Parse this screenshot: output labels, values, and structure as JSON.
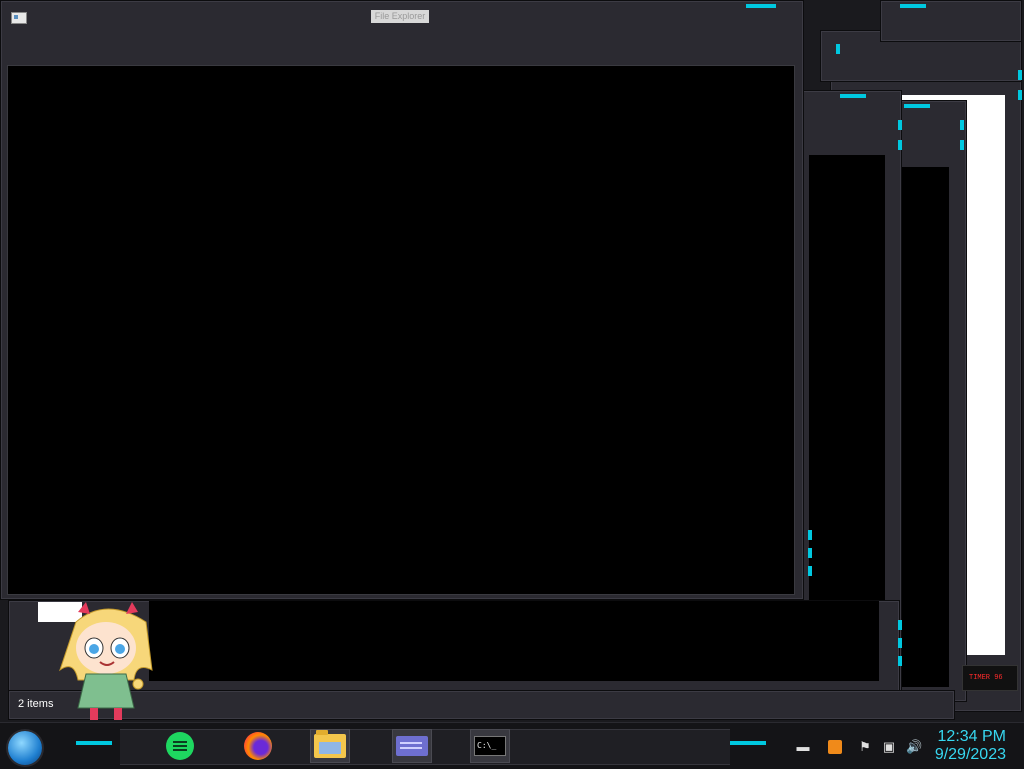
{
  "window": {
    "title": "File Explorer"
  },
  "status_bar": {
    "items_count": "2 items"
  },
  "taskbar": {
    "apps": [
      {
        "name": "spotify-icon"
      },
      {
        "name": "firefox-icon"
      },
      {
        "name": "folder-icon"
      },
      {
        "name": "app-card-icon"
      },
      {
        "name": "terminal-icon"
      }
    ],
    "terminal_glyph": "C:\\_",
    "tray": {
      "time": "12:34 PM",
      "date": "9/29/2023"
    }
  },
  "colors": {
    "accent": "#00c8e0",
    "frame": "#2b2a31",
    "clock": "#37d7f0"
  },
  "overlay_sign": "TIMER 96"
}
